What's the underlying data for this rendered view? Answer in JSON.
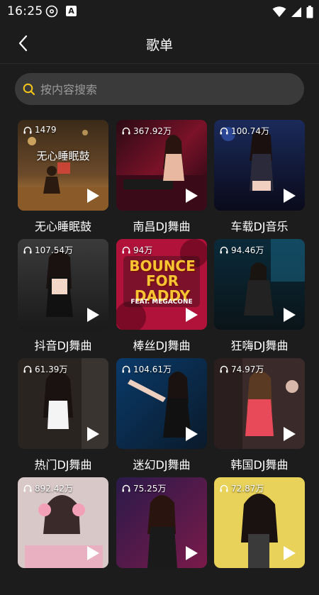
{
  "status_bar": {
    "time": "16:25",
    "app_badge": "A",
    "icons": [
      "disc-icon",
      "a-badge-icon",
      "wifi-icon",
      "signal-icon",
      "battery-icon"
    ]
  },
  "header": {
    "title": "歌单",
    "back_icon": "chevron-left-icon"
  },
  "search": {
    "placeholder": "按内容搜索",
    "value": "",
    "icon": "search-icon",
    "accent_color": "#f5c518"
  },
  "playlists": [
    {
      "title": "无心睡眠鼓",
      "plays": "1479",
      "cover_text": "无心睡眠鼓"
    },
    {
      "title": "南昌DJ舞曲",
      "plays": "367.92万"
    },
    {
      "title": "车载DJ音乐",
      "plays": "100.74万"
    },
    {
      "title": "抖音DJ舞曲",
      "plays": "107.54万"
    },
    {
      "title": "棒丝DJ舞曲",
      "plays": "94万",
      "cover_text": "BOUNCE FOR DADDY",
      "cover_sub": "FEAT. MEGACONE"
    },
    {
      "title": "狂嗨DJ舞曲",
      "plays": "94.46万"
    },
    {
      "title": "热门DJ舞曲",
      "plays": "61.39万"
    },
    {
      "title": "迷幻DJ舞曲",
      "plays": "104.61万"
    },
    {
      "title": "韩国DJ舞曲",
      "plays": "74.97万"
    },
    {
      "title": "",
      "plays": "892.42万"
    },
    {
      "title": "",
      "plays": "75.25万"
    },
    {
      "title": "",
      "plays": "72.87万"
    }
  ],
  "colors": {
    "background": "#1c1c1c",
    "search_bg": "#3a3a3a",
    "text": "#ffffff",
    "placeholder": "#9a9a9a"
  }
}
